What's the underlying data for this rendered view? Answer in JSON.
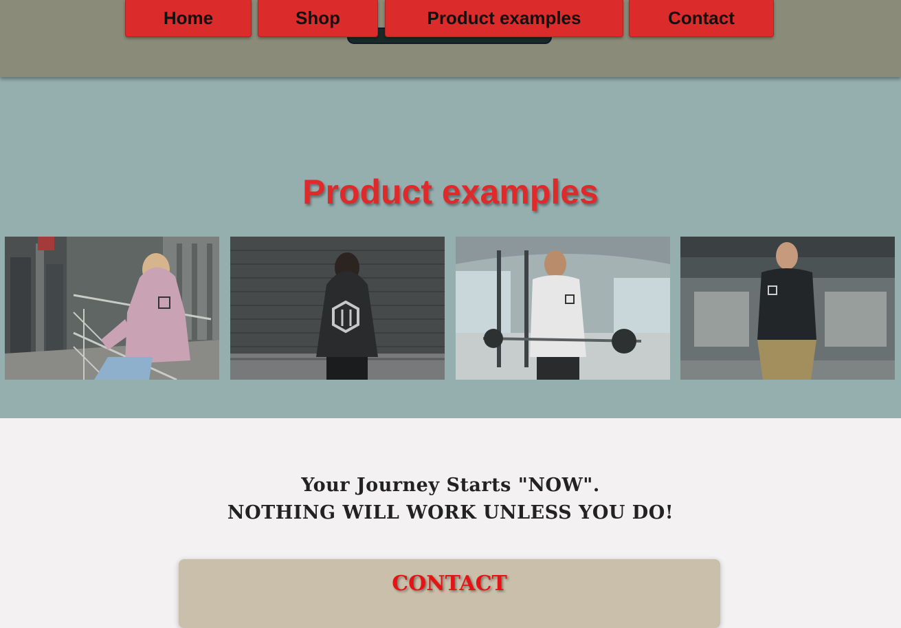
{
  "nav": {
    "home": "Home",
    "shop": "Shop",
    "product_examples": "Product examples",
    "contact": "Contact"
  },
  "products": {
    "title": "Product examples",
    "images": [
      {
        "alt": "woman in pink hoodie on stairs"
      },
      {
        "alt": "man in black hoodie against brick wall"
      },
      {
        "alt": "man in white t-shirt lifting barbell in gym"
      },
      {
        "alt": "man in black hoodie in subway"
      }
    ]
  },
  "motto": {
    "line1": "Your Journey Starts \"NOW\".",
    "line2": "NOTHING WILL WORK UNLESS YOU DO!"
  },
  "contact": {
    "title": "CONTACT"
  },
  "colors": {
    "header_bg": "#8a8c79",
    "nav_button": "#dc2b2b",
    "products_bg": "#95aeae",
    "title_red": "#de2a2a",
    "page_bg": "#f3f1f2",
    "contact_bg": "#c9bfaa",
    "contact_title": "#e41414"
  }
}
